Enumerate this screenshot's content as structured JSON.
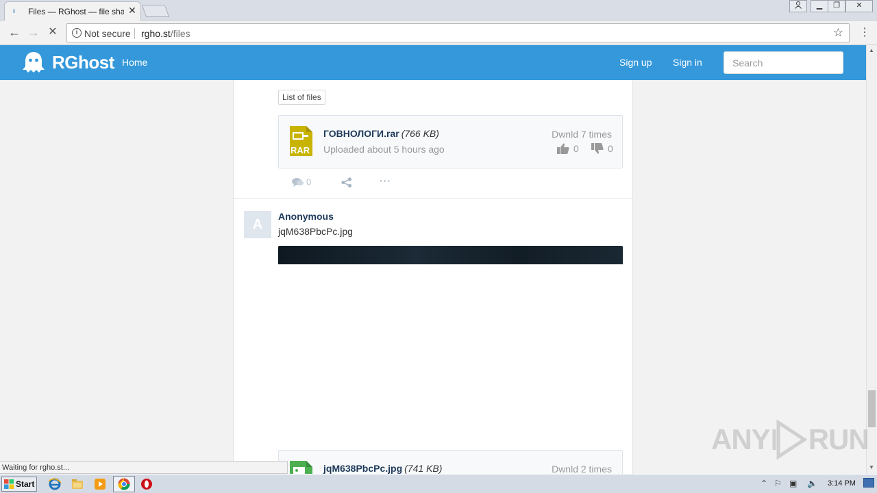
{
  "browser": {
    "tab_title": "Files — RGhost — file sharing",
    "security_label": "Not secure",
    "url_host": "rgho.st",
    "url_path": "/files",
    "status_text": "Waiting for rgho.st..."
  },
  "header": {
    "logo_text": "RGhost",
    "nav_home": "Home",
    "nav_signup": "Sign up",
    "nav_signin": "Sign in",
    "search_placeholder": "Search"
  },
  "feed": {
    "tag_label": "List of files",
    "file1": {
      "name": "ГОВНОЛОГИ.rar",
      "size": "(766 KB)",
      "uploaded": "Uploaded about 5 hours ago",
      "downloads": "Dwnld 7 times",
      "likes": "0",
      "dislikes": "0",
      "icon_label": "RAR"
    },
    "post_actions": {
      "comments": "0"
    },
    "post2": {
      "avatar_letter": "A",
      "author": "Anonymous",
      "title": "jqM638PbcPc.jpg"
    },
    "file2": {
      "name": "jqM638PbcPc.jpg",
      "size": "(741 KB)",
      "downloads": "Dwnld 2 times"
    }
  },
  "watermark": {
    "text_left": "ANY",
    "text_right": "RUN"
  },
  "taskbar": {
    "start_label": "Start",
    "clock": "3:14 PM"
  },
  "colors": {
    "header_bg": "#3498db",
    "file_link": "#1e3a5a",
    "rar_icon": "#c8b400",
    "jpg_icon": "#4caf50"
  }
}
